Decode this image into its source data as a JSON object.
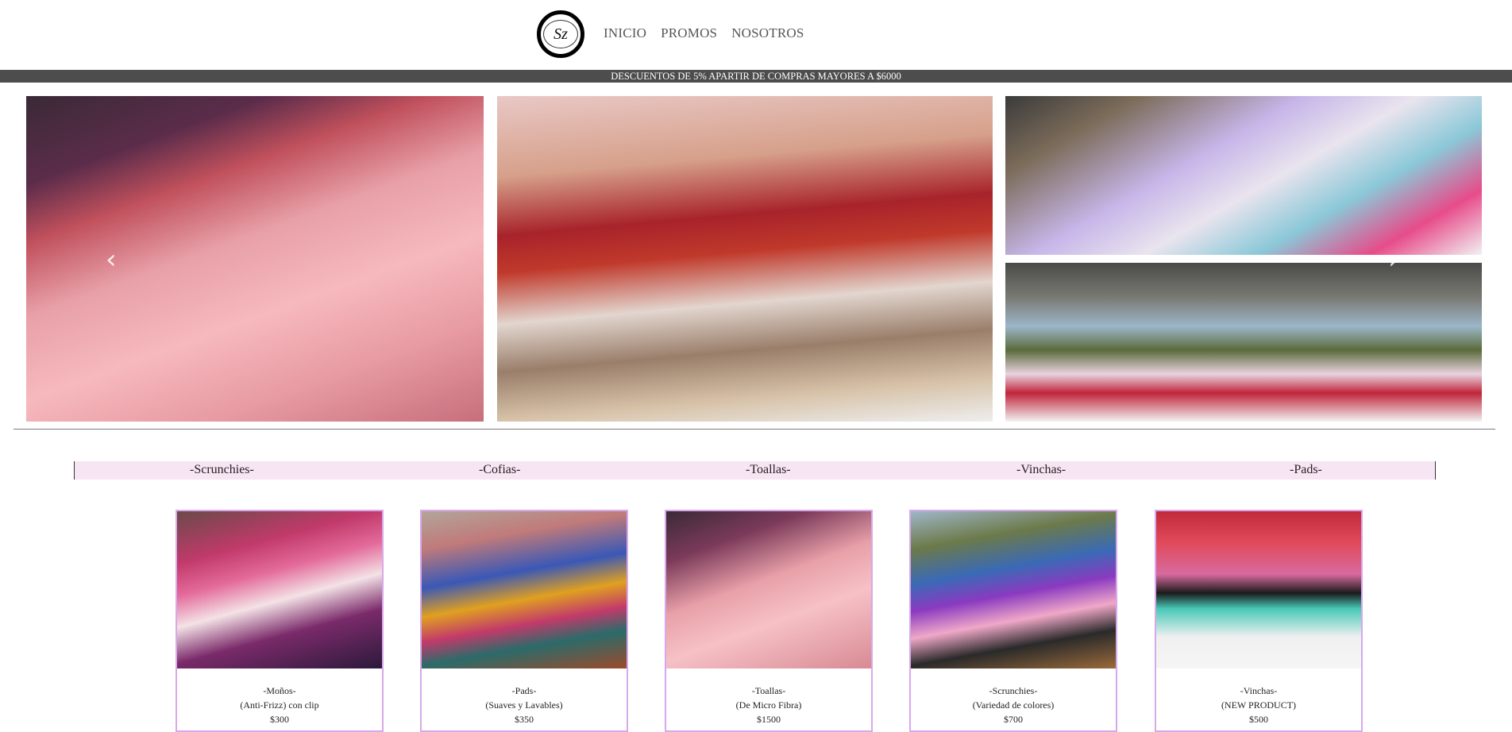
{
  "brand": {
    "logo_text": "Sz"
  },
  "nav": {
    "items": [
      "INICIO",
      "PROMOS",
      "NOSOTROS"
    ]
  },
  "promo_bar": {
    "text": "DESCUENTOS DE 5% APARTIR DE COMPRAS MAYORES A $6000"
  },
  "carousel": {
    "prev_icon": "chevron-left-icon",
    "next_icon": "chevron-right-icon"
  },
  "categories": [
    "-Scrunchies-",
    "-Cofias-",
    "-Toallas-",
    "-Vinchas-",
    "-Pads-"
  ],
  "products": [
    {
      "name": "-Moños-",
      "detail": "(Anti-Frizz) con clip",
      "price": "$300"
    },
    {
      "name": "-Pads-",
      "detail": "(Suaves y Lavables)",
      "price": "$350"
    },
    {
      "name": "-Toallas-",
      "detail": "(De Micro Fibra)",
      "price": "$1500"
    },
    {
      "name": "-Scrunchies-",
      "detail": "(Variedad de colores)",
      "price": "$700"
    },
    {
      "name": "-Vinchas-",
      "detail": "(NEW PRODUCT)",
      "price": "$500"
    }
  ],
  "colors": {
    "promo_bg": "#4d4d4d",
    "category_bg": "#f8e5f4",
    "card_border": "#d7a8ea"
  }
}
